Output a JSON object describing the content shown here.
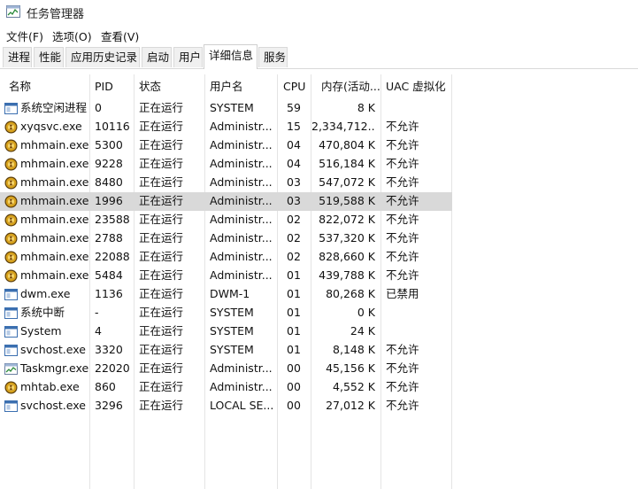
{
  "window": {
    "title": "任务管理器"
  },
  "menu": [
    "文件(F)",
    "选项(O)",
    "查看(V)"
  ],
  "tabs": [
    "进程",
    "性能",
    "应用历史记录",
    "启动",
    "用户",
    "详细信息",
    "服务"
  ],
  "active_tab": "详细信息",
  "columns": {
    "name": "名称",
    "pid": "PID",
    "status": "状态",
    "user": "用户名",
    "cpu": "CPU",
    "memory": "内存(活动...",
    "uac": "UAC 虚拟化"
  },
  "rows": [
    {
      "icon": "window-icon",
      "name": "系统空闲进程",
      "pid": "0",
      "status": "正在运行",
      "user": "SYSTEM",
      "cpu": "59",
      "memory": "8 K",
      "uac": ""
    },
    {
      "icon": "gold-coin-app-icon",
      "name": "xyqsvc.exe",
      "pid": "10116",
      "status": "正在运行",
      "user": "Administr...",
      "cpu": "15",
      "memory": "2,334,712...",
      "uac": "不允许"
    },
    {
      "icon": "gold-coin-app-icon",
      "name": "mhmain.exe",
      "pid": "5300",
      "status": "正在运行",
      "user": "Administr...",
      "cpu": "04",
      "memory": "470,804 K",
      "uac": "不允许"
    },
    {
      "icon": "gold-coin-app-icon",
      "name": "mhmain.exe",
      "pid": "9228",
      "status": "正在运行",
      "user": "Administr...",
      "cpu": "04",
      "memory": "516,184 K",
      "uac": "不允许"
    },
    {
      "icon": "gold-coin-app-icon",
      "name": "mhmain.exe",
      "pid": "8480",
      "status": "正在运行",
      "user": "Administr...",
      "cpu": "03",
      "memory": "547,072 K",
      "uac": "不允许"
    },
    {
      "icon": "gold-coin-app-icon",
      "name": "mhmain.exe",
      "pid": "1996",
      "status": "正在运行",
      "user": "Administr...",
      "cpu": "03",
      "memory": "519,588 K",
      "uac": "不允许",
      "selected": true
    },
    {
      "icon": "gold-coin-app-icon",
      "name": "mhmain.exe",
      "pid": "23588",
      "status": "正在运行",
      "user": "Administr...",
      "cpu": "02",
      "memory": "822,072 K",
      "uac": "不允许"
    },
    {
      "icon": "gold-coin-app-icon",
      "name": "mhmain.exe",
      "pid": "2788",
      "status": "正在运行",
      "user": "Administr...",
      "cpu": "02",
      "memory": "537,320 K",
      "uac": "不允许"
    },
    {
      "icon": "gold-coin-app-icon",
      "name": "mhmain.exe",
      "pid": "22088",
      "status": "正在运行",
      "user": "Administr...",
      "cpu": "02",
      "memory": "828,660 K",
      "uac": "不允许"
    },
    {
      "icon": "gold-coin-app-icon",
      "name": "mhmain.exe",
      "pid": "5484",
      "status": "正在运行",
      "user": "Administr...",
      "cpu": "01",
      "memory": "439,788 K",
      "uac": "不允许"
    },
    {
      "icon": "window-icon",
      "name": "dwm.exe",
      "pid": "1136",
      "status": "正在运行",
      "user": "DWM-1",
      "cpu": "01",
      "memory": "80,268 K",
      "uac": "已禁用"
    },
    {
      "icon": "window-icon",
      "name": "系统中断",
      "pid": "-",
      "status": "正在运行",
      "user": "SYSTEM",
      "cpu": "01",
      "memory": "0 K",
      "uac": ""
    },
    {
      "icon": "window-icon",
      "name": "System",
      "pid": "4",
      "status": "正在运行",
      "user": "SYSTEM",
      "cpu": "01",
      "memory": "24 K",
      "uac": ""
    },
    {
      "icon": "window-icon",
      "name": "svchost.exe",
      "pid": "3320",
      "status": "正在运行",
      "user": "SYSTEM",
      "cpu": "01",
      "memory": "8,148 K",
      "uac": "不允许"
    },
    {
      "icon": "task-manager-icon",
      "name": "Taskmgr.exe",
      "pid": "22020",
      "status": "正在运行",
      "user": "Administr...",
      "cpu": "00",
      "memory": "45,156 K",
      "uac": "不允许"
    },
    {
      "icon": "gold-coin-app-icon",
      "name": "mhtab.exe",
      "pid": "860",
      "status": "正在运行",
      "user": "Administr...",
      "cpu": "00",
      "memory": "4,552 K",
      "uac": "不允许"
    },
    {
      "icon": "window-icon",
      "name": "svchost.exe",
      "pid": "3296",
      "status": "正在运行",
      "user": "LOCAL SE...",
      "cpu": "00",
      "memory": "27,012 K",
      "uac": "不允许"
    }
  ],
  "colors": {
    "selected_row": "#d9d9d9",
    "coin_gold": "#d8a21c",
    "window_icon_blue": "#2b6cb5"
  }
}
